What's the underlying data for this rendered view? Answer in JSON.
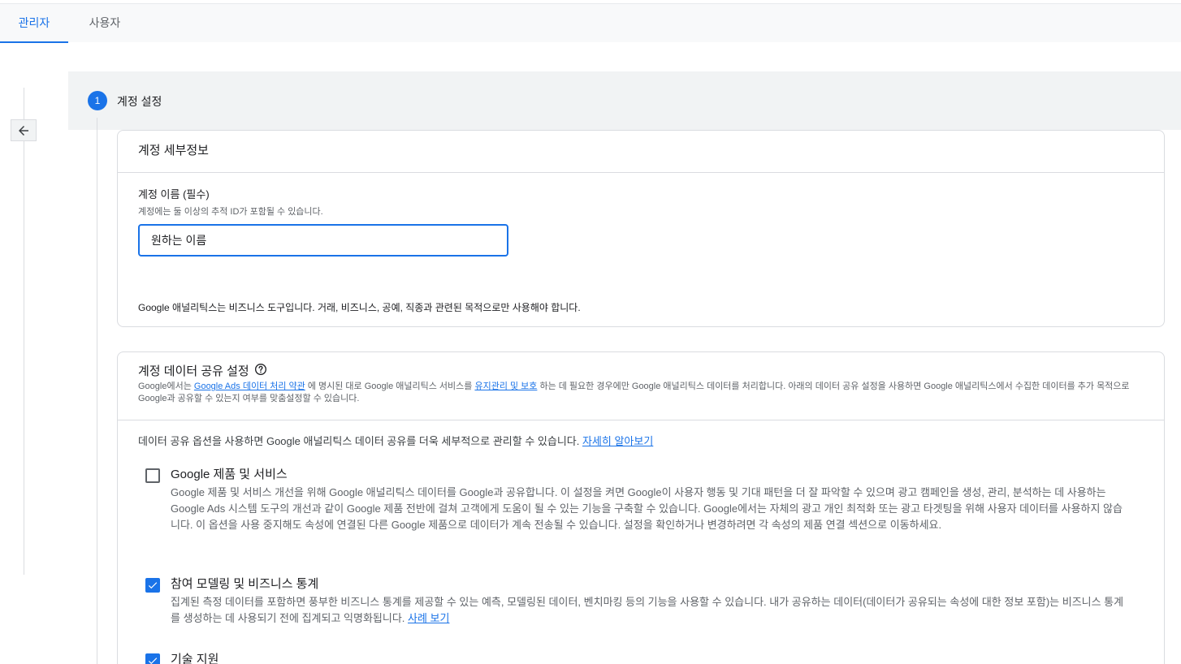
{
  "tabs": {
    "admin": "관리자",
    "user": "사용자"
  },
  "step": {
    "number": "1",
    "title": "계정 설정"
  },
  "account_details": {
    "title": "계정 세부정보",
    "field_label": "계정 이름 (필수)",
    "field_hint": "계정에는 둘 이상의 추적 ID가 포함될 수 있습니다.",
    "field_value": "원하는 이름",
    "disclaimer": "Google 애널리틱스는 비즈니스 도구입니다. 거래, 비즈니스, 공예, 직종과 관련된 목적으로만 사용해야 합니다."
  },
  "data_sharing": {
    "title": "계정 데이터 공유 설정",
    "desc_part1": "Google에서는 ",
    "desc_link1": "Google Ads 데이터 처리 약관",
    "desc_part2": " 에 명시된 대로 Google 애널리틱스 서비스를 ",
    "desc_link2": "유지관리 및 보호",
    "desc_part3": " 하는 데 필요한 경우에만 Google 애널리틱스 데이터를 처리합니다. 아래의 데이터 공유 설정을 사용하면 Google 애널리틱스에서 수집한 데이터를 추가 목적으로 Google과 공유할 수 있는지 여부를 맞춤설정할 수 있습니다.",
    "intro": "데이터 공유 옵션을 사용하면 Google 애널리틱스 데이터 공유를 더욱 세부적으로 관리할 수 있습니다. ",
    "intro_link": "자세히 알아보기",
    "options": [
      {
        "title": "Google 제품 및 서비스",
        "checked": false,
        "desc": "Google 제품 및 서비스 개선을 위해 Google 애널리틱스 데이터를 Google과 공유합니다. 이 설정을 켜면 Google이 사용자 행동 및 기대 패턴을 더 잘 파악할 수 있으며 광고 캠페인을 생성, 관리, 분석하는 데 사용하는 Google Ads 시스템 도구의 개선과 같이 Google 제품 전반에 걸쳐 고객에게 도움이 될 수 있는 기능을 구축할 수 있습니다. Google에서는 자체의 광고 개인 최적화 또는 광고 타겟팅을 위해 사용자 데이터를 사용하지 않습니다. 이 옵션을 사용 중지해도 속성에 연결된 다른 Google 제품으로 데이터가 계속 전송될 수 있습니다. 설정을 확인하거나 변경하려면 각 속성의 제품 연결 섹션으로 이동하세요."
      },
      {
        "title": "참여 모델링 및 비즈니스 통계",
        "checked": true,
        "desc": "집계된 측정 데이터를 포함하면 풍부한 비즈니스 통계를 제공할 수 있는 예측, 모델링된 데이터, 벤치마킹 등의 기능을 사용할 수 있습니다. 내가 공유하는 데이터(데이터가 공유되는 속성에 대한 정보 포함)는 비즈니스 통계를 생성하는 데 사용되기 전에 집계되고 익명화됩니다. ",
        "link": "사례 보기"
      },
      {
        "title": "기술 지원",
        "checked": true
      }
    ]
  }
}
